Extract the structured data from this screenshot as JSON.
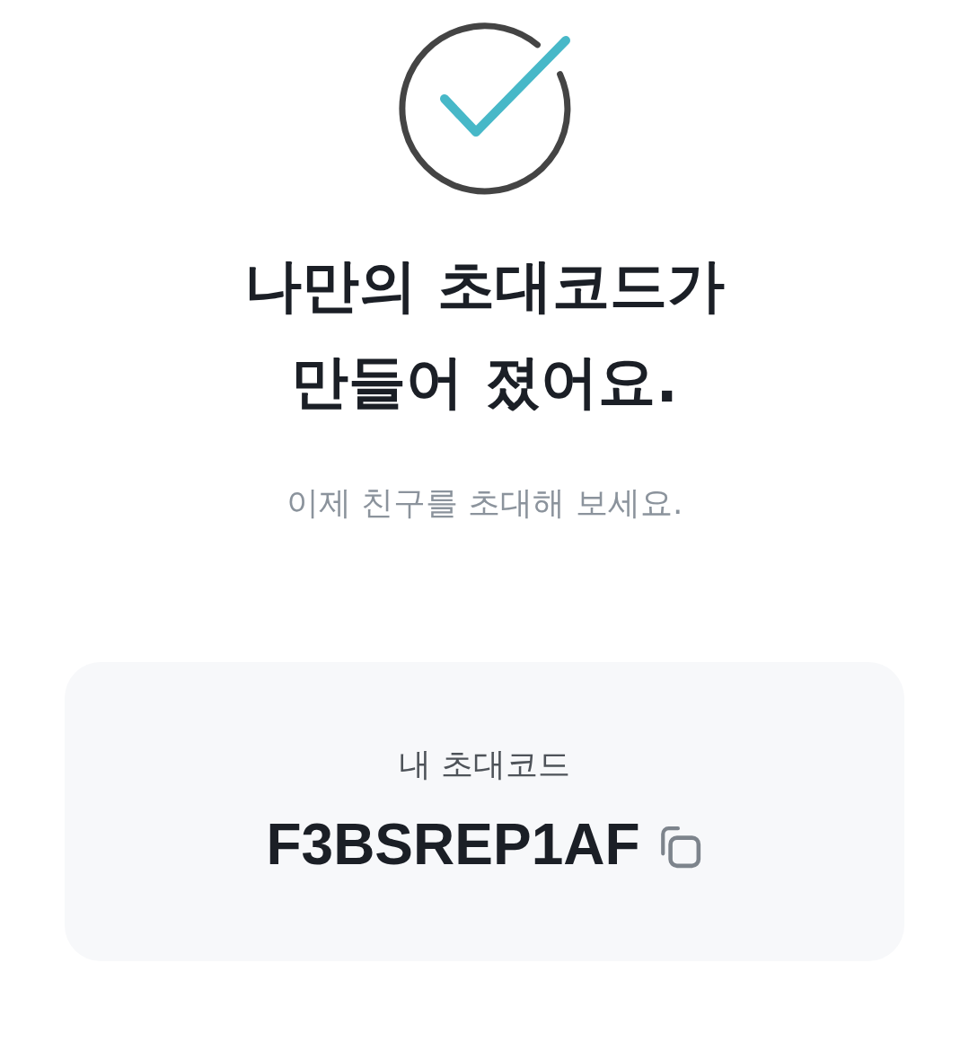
{
  "title": "나만의 초대코드가 만들어 졌어요.",
  "subtitle": "이제 친구를 초대해 보세요.",
  "invite_card": {
    "label": "내 초대코드",
    "code": "F3BSREP1AF"
  }
}
